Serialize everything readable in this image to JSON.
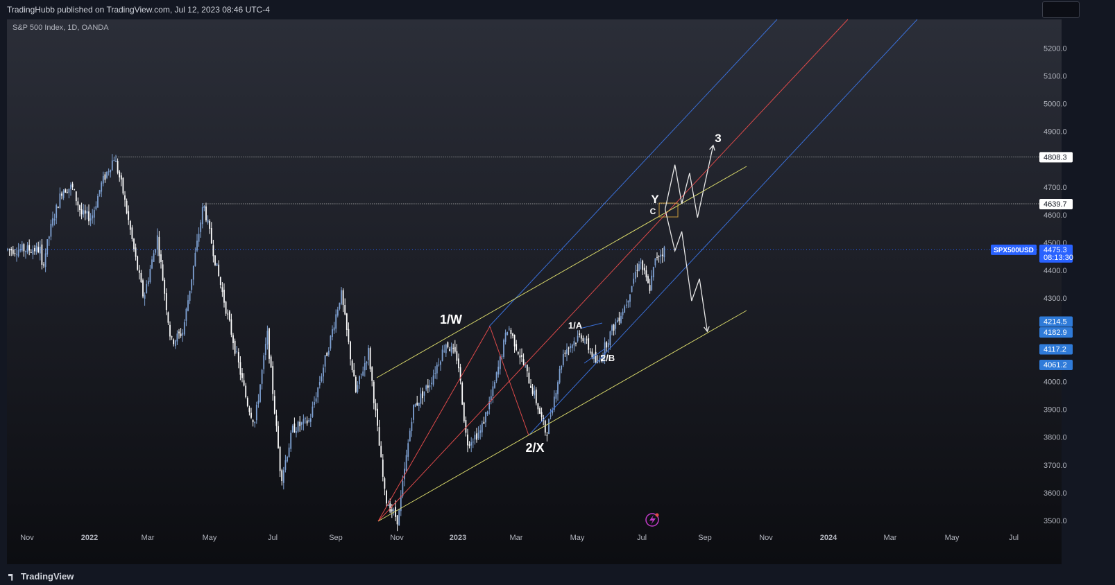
{
  "header": {
    "publish_text": "TradingHubb published on TradingView.com, Jul 12, 2023 08:46 UTC-4"
  },
  "chart_header": {
    "symbol_text": "S&P 500 Index, 1D, OANDA"
  },
  "footer": {
    "brand": "TradingView"
  },
  "colors": {
    "bull": "#7fa2d4",
    "bear": "#ffffff",
    "upper_channel": "#3a6fd8",
    "median": "#e04a4a",
    "lower_channel": "#3a6fd8",
    "wedge": "#d8d86a",
    "projection": "#e8e8e8",
    "price_tag": "#2962ff",
    "marker_tag": "#2f7bd9"
  },
  "chart_data": {
    "type": "candlestick",
    "symbol": "SPX500USD",
    "timeframe": "1D",
    "source": "OANDA",
    "x_tick_labels": [
      "Nov",
      "2022",
      "Mar",
      "May",
      "Jul",
      "Sep",
      "Nov",
      "2023",
      "Mar",
      "May",
      "Jul",
      "Sep",
      "Nov",
      "2024",
      "Mar",
      "May",
      "Jul"
    ],
    "y_tick_labels": [
      "5200.0",
      "5100.0",
      "5000.0",
      "4900.0",
      "4700.0",
      "4600.0",
      "4500.0",
      "4400.0",
      "4300.0",
      "4000.0",
      "3900.0",
      "3800.0",
      "3700.0",
      "3600.0",
      "3500.0"
    ],
    "ylim": [
      3500,
      5200
    ],
    "price_path": [
      [
        "2021-10-15",
        4400
      ],
      [
        "2021-10-25",
        4560
      ],
      [
        "2021-11-05",
        4690
      ],
      [
        "2021-11-15",
        4700
      ],
      [
        "2021-11-25",
        4600
      ],
      [
        "2021-12-05",
        4590
      ],
      [
        "2021-12-15",
        4710
      ],
      [
        "2021-12-28",
        4808
      ],
      [
        "2022-01-05",
        4700
      ],
      [
        "2022-01-20",
        4420
      ],
      [
        "2022-01-27",
        4300
      ],
      [
        "2022-02-10",
        4520
      ],
      [
        "2022-02-24",
        4140
      ],
      [
        "2022-03-08",
        4180
      ],
      [
        "2022-03-29",
        4640
      ],
      [
        "2022-04-12",
        4400
      ],
      [
        "2022-04-28",
        4150
      ],
      [
        "2022-05-12",
        3930
      ],
      [
        "2022-05-20",
        3850
      ],
      [
        "2022-06-02",
        4170
      ],
      [
        "2022-06-16",
        3650
      ],
      [
        "2022-06-28",
        3830
      ],
      [
        "2022-07-15",
        3860
      ],
      [
        "2022-08-05",
        4150
      ],
      [
        "2022-08-16",
        4320
      ],
      [
        "2022-08-31",
        3960
      ],
      [
        "2022-09-13",
        4110
      ],
      [
        "2022-09-30",
        3580
      ],
      [
        "2022-10-13",
        3500
      ],
      [
        "2022-10-28",
        3900
      ],
      [
        "2022-11-15",
        4000
      ],
      [
        "2022-12-01",
        4140
      ],
      [
        "2022-12-13",
        4080
      ],
      [
        "2022-12-22",
        3780
      ],
      [
        "2023-01-05",
        3820
      ],
      [
        "2023-01-18",
        3970
      ],
      [
        "2023-02-02",
        4200
      ],
      [
        "2023-02-16",
        4080
      ],
      [
        "2023-03-01",
        3950
      ],
      [
        "2023-03-13",
        3810
      ],
      [
        "2023-03-31",
        4110
      ],
      [
        "2023-04-18",
        4170
      ],
      [
        "2023-05-04",
        4060
      ],
      [
        "2023-05-18",
        4180
      ],
      [
        "2023-06-02",
        4280
      ],
      [
        "2023-06-16",
        4440
      ],
      [
        "2023-06-26",
        4330
      ],
      [
        "2023-07-03",
        4450
      ],
      [
        "2023-07-12",
        4475.3
      ]
    ],
    "horizontal_levels": [
      4808.3,
      4639.7,
      4475.3
    ],
    "price_tags": [
      {
        "value": 4808.3,
        "label": "4808.3",
        "style": "white"
      },
      {
        "value": 4639.7,
        "label": "4639.7",
        "style": "white"
      },
      {
        "value": 4475.3,
        "label": "4475.3",
        "style": "blue",
        "sub": "08:13:30",
        "symbol_tag": "SPX500USD"
      },
      {
        "value": 4214.5,
        "label": "4214.5",
        "style": "lightblue"
      },
      {
        "value": 4182.9,
        "label": "4182.9",
        "style": "lightblue"
      },
      {
        "value": 4117.2,
        "label": "4117.2",
        "style": "lightblue"
      },
      {
        "value": 4061.2,
        "label": "4061.2",
        "style": "lightblue"
      }
    ],
    "wave_labels": [
      "1/W",
      "2/X",
      "1/A",
      "2/B",
      "Y",
      "C",
      "3"
    ],
    "projections": {
      "bullish": [
        [
          "2023-07-12",
          4620
        ],
        [
          "2023-07-22",
          4780
        ],
        [
          "2023-07-29",
          4640
        ],
        [
          "2023-08-06",
          4750
        ],
        [
          "2023-08-14",
          4590
        ],
        [
          "2023-08-30",
          4850
        ]
      ],
      "bearish": [
        [
          "2023-07-12",
          4620
        ],
        [
          "2023-07-22",
          4470
        ],
        [
          "2023-07-29",
          4540
        ],
        [
          "2023-08-08",
          4290
        ],
        [
          "2023-08-16",
          4370
        ],
        [
          "2023-08-24",
          4180
        ]
      ]
    },
    "grid": false,
    "legend": "none"
  }
}
